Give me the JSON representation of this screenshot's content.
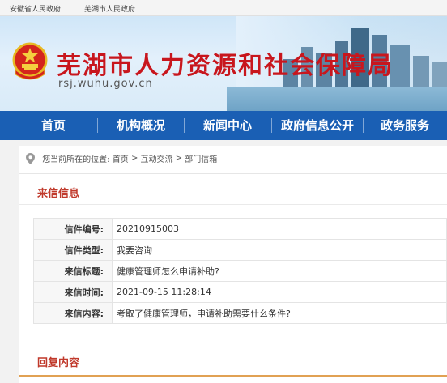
{
  "top_links": [
    "安徽省人民政府",
    "芜湖市人民政府"
  ],
  "banner": {
    "title": "芜湖市人力资源和社会保障局",
    "url": "rsj.wuhu.gov.cn"
  },
  "nav": [
    "首页",
    "机构概况",
    "新闻中心",
    "政府信息公开",
    "政务服务"
  ],
  "breadcrumb": {
    "prefix": "您当前所在的位置:",
    "items": [
      "首页",
      "互动交流",
      "部门信箱"
    ],
    "separator": ">"
  },
  "letter_section": {
    "title": "来信信息",
    "rows": [
      {
        "label": "信件编号:",
        "value": "20210915003"
      },
      {
        "label": "信件类型:",
        "value": "我要咨询"
      },
      {
        "label": "来信标题:",
        "value": "健康管理师怎么申请补助?"
      },
      {
        "label": "来信时间:",
        "value": "2021-09-15 11:28:14"
      },
      {
        "label": "来信内容:",
        "value": "考取了健康管理师，申请补助需要什么条件?"
      }
    ]
  },
  "reply_section": {
    "title": "回复内容"
  },
  "colors": {
    "nav_bg": "#1a5fb4",
    "title_red": "#c8161d",
    "section_title": "#c0392b",
    "accent_line": "#e1a153"
  }
}
